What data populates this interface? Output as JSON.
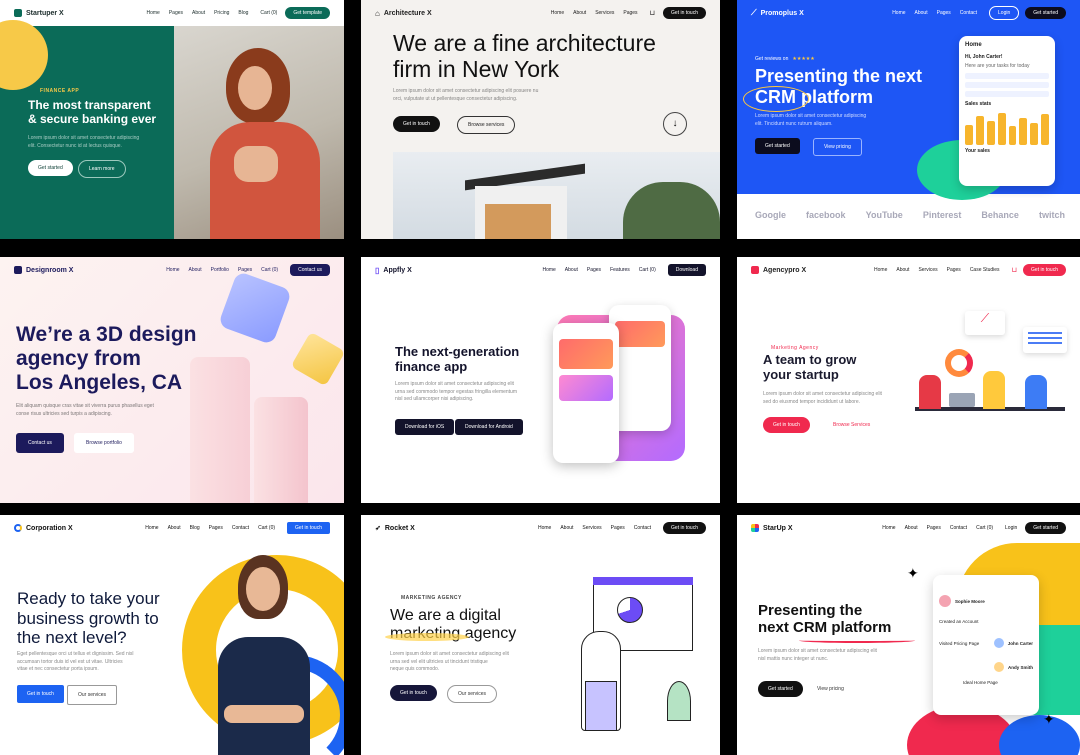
{
  "tiles": [
    {
      "brand": "Startuper X",
      "nav": [
        "Home",
        "Pages",
        "About",
        "Pricing",
        "Blog"
      ],
      "cart": "Cart (0)",
      "cta": "Get template",
      "tag": "FINANCE APP",
      "headline": "The most transparent\n& secure banking ever",
      "body": "Lorem ipsum dolor sit amet consectetur adipiscing\nelit. Consectetur nunc id at lectus quisque.",
      "primary": "Get started",
      "secondary": "Learn more"
    },
    {
      "brand": "Architecture X",
      "nav": [
        "Home",
        "About",
        "Services",
        "Pages"
      ],
      "cta": "Get in touch",
      "headline": "We are a fine architecture\nfirm in New York",
      "body": "Lorem ipsum dolor sit amet consectetur adipiscing elit posuere nu\norci, vulputate ut ut pellentesque consectetur adipiscing.",
      "primary": "Get in touch",
      "secondary": "Browse services"
    },
    {
      "brand": "Promoplus X",
      "nav": [
        "Home",
        "About",
        "Pages",
        "Contact"
      ],
      "login": "Login",
      "cta": "Get started",
      "rating_label": "Get reviews on",
      "stars": "★★★★★",
      "headline": "Presenting the next\nCRM platform",
      "body": "Lorem ipsum dolor sit amet consectetur adipiscing\nelit. Tincidunt nunc rutrum aliquam.",
      "primary": "Get started",
      "secondary": "View pricing",
      "card_title": "Home",
      "card_greeting": "Hi, John Carter!",
      "card_tasks": "Here are your tasks for today",
      "card_sales": "Sales stats",
      "card_visits": "Your sales",
      "logos": [
        "Google",
        "facebook",
        "YouTube",
        "Pinterest",
        "Behance",
        "twitch"
      ]
    },
    {
      "brand": "Designroom X",
      "nav": [
        "Home",
        "About",
        "Portfolio",
        "Pages",
        "Cart (0)"
      ],
      "cta": "Contact us",
      "headline": "We’re a 3D design\nagency from\nLos Angeles, CA",
      "body": "Elit aliquam quisque cras vitae sit viverra purus phasellus eget\nconse risus ultricies sed turpis a adipiscing.",
      "primary": "Contact us",
      "secondary": "Browse portfolio"
    },
    {
      "brand": "Appfly X",
      "nav": [
        "Home",
        "About",
        "Pages",
        "Features",
        "Cart (0)"
      ],
      "cta": "Download",
      "headline": "The next-generation\nfinance app",
      "body": "Lorem ipsum dolor sit amet consectetur adipiscing elit\nurna sed commodo tempor egestas fringilla elementum\nnisl sed ullamcorper nisi adipiscing.",
      "primary": "Download for iOS",
      "secondary": "Download for Android"
    },
    {
      "brand": "Agencypro X",
      "nav": [
        "Home",
        "About",
        "Services",
        "Pages",
        "Case Studies"
      ],
      "cta": "Get in touch",
      "tag": "Marketing Agency",
      "headline": "A team to grow\nyour startup",
      "body": "Lorem ipsum dolor sit amet consectetur adipiscing elit\nsed do eiusmod tempor incididunt ut labore.",
      "primary": "Get in touch",
      "secondary": "Browse Services"
    },
    {
      "brand": "Corporation X",
      "nav": [
        "Home",
        "About",
        "Blog",
        "Pages",
        "Contact",
        "Cart (0)"
      ],
      "cta": "Get in touch",
      "headline": "Ready to take your\nbusiness growth to\nthe next level?",
      "body": "Eget pellentesque orci ut tellus et dignissim. Sed nisl\naccumsan tortor duis id vel est ut vitae. Ultricies\nvitae et nec consectetur porta ipsum.",
      "primary": "Get in touch",
      "secondary": "Our services"
    },
    {
      "brand": "Rocket X",
      "nav": [
        "Home",
        "About",
        "Services",
        "Pages",
        "Contact"
      ],
      "cta": "Get in touch",
      "tag": "MARKETING AGENCY",
      "headline": "We are a digital\nmarketing agency",
      "body": "Lorem ipsum dolor sit amet consectetur adipiscing elit\nurna sed vel elit ultricies ut tincidunt tristique\nneque quis commodo.",
      "primary": "Get in touch",
      "secondary": "Our services"
    },
    {
      "brand": "StarUp X",
      "nav": [
        "Home",
        "About",
        "Pages",
        "Contact",
        "Cart (0)"
      ],
      "login": "Login",
      "cta": "Get started",
      "headline": "Presenting the\nnext CRM platform",
      "body": "Lorem ipsum dolor sit amet consectetur adipiscing elit\nnisl mattis nunc integer ut nunc.",
      "primary": "Get started",
      "secondary": "View pricing",
      "contacts": [
        "Sophie Moore",
        "John Carter",
        "Andy Smith"
      ],
      "events": [
        "Created an Account",
        "Visited Pricing Page",
        "Ideal Home Page"
      ]
    }
  ],
  "colors": {
    "startuper_bg": "#0b6b58",
    "startuper_accent": "#f7c948",
    "architecture_bg": "#f4f2ef",
    "promo_bg": "#1e56f5",
    "designroom_ink": "#1c1a5c",
    "appfly_ink": "#13132b",
    "agency_accent": "#f0294e",
    "corp_blue": "#1d63f2",
    "corp_yellow": "#f8c21a",
    "startup_red": "#f0294e"
  }
}
